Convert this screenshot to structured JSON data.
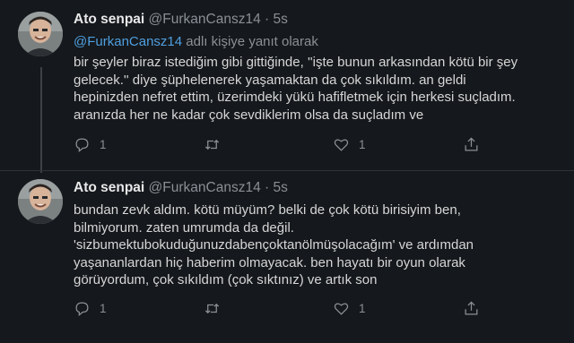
{
  "tweets": [
    {
      "name": "Ato senpai",
      "handle": "@FurkanCansz14",
      "separator": "·",
      "time": "5s",
      "reply_handle": "@FurkanCansz14",
      "reply_suffix": " adlı kişiye yanıt olarak",
      "lines": [
        "bir şeyler biraz istediğim gibi gittiğinde, ''işte bunun arkasından kötü bir şey",
        "gelecek.'' diye şüphelenerek yaşamaktan da çok sıkıldım. an geldi",
        "hepinizden nefret ettim, üzerimdeki yükü hafifletmek için herkesi suçladım.",
        "aranızda her ne kadar çok sevdiklerim olsa da suçladım ve"
      ],
      "reply_count": "1",
      "retweet_count": "",
      "like_count": "1"
    },
    {
      "name": "Ato senpai",
      "handle": "@FurkanCansz14",
      "separator": "·",
      "time": "5s",
      "lines": [
        "bundan zevk aldım. kötü müyüm? belki de çok kötü birisiyim ben,",
        "bilmiyorum. zaten umrumda da değil.",
        "'sizbumektubokuduğunuzdabençoktanölmüşolacağım' ve ardımdan",
        "yaşananlardan hiç haberim olmayacak. ben hayatı bir oyun olarak",
        "görüyordum, çok sıkıldım (çok sıktınız) ve artık son"
      ],
      "reply_count": "1",
      "retweet_count": "",
      "like_count": "1"
    }
  ],
  "icons": {
    "reply": "reply-icon",
    "retweet": "retweet-icon",
    "like": "heart-icon",
    "share": "share-icon"
  },
  "colors": {
    "background": "#15181c",
    "link": "#4f9fe0",
    "muted": "#8b9096",
    "text": "#d6d6d6"
  }
}
